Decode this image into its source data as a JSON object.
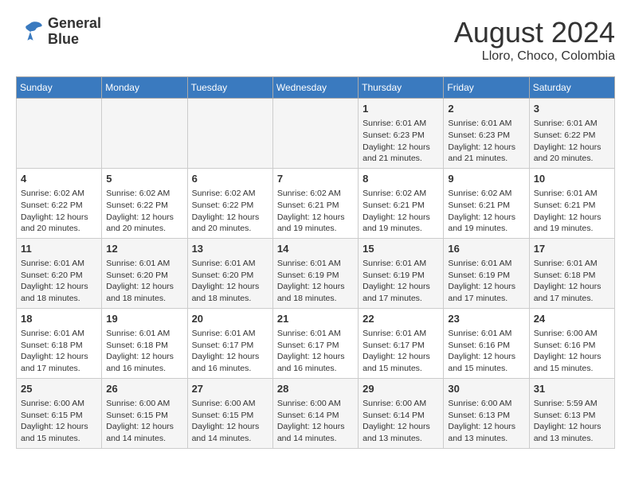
{
  "header": {
    "logo": {
      "line1": "General",
      "line2": "Blue"
    },
    "title": "August 2024",
    "subtitle": "Lloro, Choco, Colombia"
  },
  "days_of_week": [
    "Sunday",
    "Monday",
    "Tuesday",
    "Wednesday",
    "Thursday",
    "Friday",
    "Saturday"
  ],
  "weeks": [
    [
      {
        "day": "",
        "info": ""
      },
      {
        "day": "",
        "info": ""
      },
      {
        "day": "",
        "info": ""
      },
      {
        "day": "",
        "info": ""
      },
      {
        "day": "1",
        "info": "Sunrise: 6:01 AM\nSunset: 6:23 PM\nDaylight: 12 hours\nand 21 minutes."
      },
      {
        "day": "2",
        "info": "Sunrise: 6:01 AM\nSunset: 6:23 PM\nDaylight: 12 hours\nand 21 minutes."
      },
      {
        "day": "3",
        "info": "Sunrise: 6:01 AM\nSunset: 6:22 PM\nDaylight: 12 hours\nand 20 minutes."
      }
    ],
    [
      {
        "day": "4",
        "info": "Sunrise: 6:02 AM\nSunset: 6:22 PM\nDaylight: 12 hours\nand 20 minutes."
      },
      {
        "day": "5",
        "info": "Sunrise: 6:02 AM\nSunset: 6:22 PM\nDaylight: 12 hours\nand 20 minutes."
      },
      {
        "day": "6",
        "info": "Sunrise: 6:02 AM\nSunset: 6:22 PM\nDaylight: 12 hours\nand 20 minutes."
      },
      {
        "day": "7",
        "info": "Sunrise: 6:02 AM\nSunset: 6:21 PM\nDaylight: 12 hours\nand 19 minutes."
      },
      {
        "day": "8",
        "info": "Sunrise: 6:02 AM\nSunset: 6:21 PM\nDaylight: 12 hours\nand 19 minutes."
      },
      {
        "day": "9",
        "info": "Sunrise: 6:02 AM\nSunset: 6:21 PM\nDaylight: 12 hours\nand 19 minutes."
      },
      {
        "day": "10",
        "info": "Sunrise: 6:01 AM\nSunset: 6:21 PM\nDaylight: 12 hours\nand 19 minutes."
      }
    ],
    [
      {
        "day": "11",
        "info": "Sunrise: 6:01 AM\nSunset: 6:20 PM\nDaylight: 12 hours\nand 18 minutes."
      },
      {
        "day": "12",
        "info": "Sunrise: 6:01 AM\nSunset: 6:20 PM\nDaylight: 12 hours\nand 18 minutes."
      },
      {
        "day": "13",
        "info": "Sunrise: 6:01 AM\nSunset: 6:20 PM\nDaylight: 12 hours\nand 18 minutes."
      },
      {
        "day": "14",
        "info": "Sunrise: 6:01 AM\nSunset: 6:19 PM\nDaylight: 12 hours\nand 18 minutes."
      },
      {
        "day": "15",
        "info": "Sunrise: 6:01 AM\nSunset: 6:19 PM\nDaylight: 12 hours\nand 17 minutes."
      },
      {
        "day": "16",
        "info": "Sunrise: 6:01 AM\nSunset: 6:19 PM\nDaylight: 12 hours\nand 17 minutes."
      },
      {
        "day": "17",
        "info": "Sunrise: 6:01 AM\nSunset: 6:18 PM\nDaylight: 12 hours\nand 17 minutes."
      }
    ],
    [
      {
        "day": "18",
        "info": "Sunrise: 6:01 AM\nSunset: 6:18 PM\nDaylight: 12 hours\nand 17 minutes."
      },
      {
        "day": "19",
        "info": "Sunrise: 6:01 AM\nSunset: 6:18 PM\nDaylight: 12 hours\nand 16 minutes."
      },
      {
        "day": "20",
        "info": "Sunrise: 6:01 AM\nSunset: 6:17 PM\nDaylight: 12 hours\nand 16 minutes."
      },
      {
        "day": "21",
        "info": "Sunrise: 6:01 AM\nSunset: 6:17 PM\nDaylight: 12 hours\nand 16 minutes."
      },
      {
        "day": "22",
        "info": "Sunrise: 6:01 AM\nSunset: 6:17 PM\nDaylight: 12 hours\nand 15 minutes."
      },
      {
        "day": "23",
        "info": "Sunrise: 6:01 AM\nSunset: 6:16 PM\nDaylight: 12 hours\nand 15 minutes."
      },
      {
        "day": "24",
        "info": "Sunrise: 6:00 AM\nSunset: 6:16 PM\nDaylight: 12 hours\nand 15 minutes."
      }
    ],
    [
      {
        "day": "25",
        "info": "Sunrise: 6:00 AM\nSunset: 6:15 PM\nDaylight: 12 hours\nand 15 minutes."
      },
      {
        "day": "26",
        "info": "Sunrise: 6:00 AM\nSunset: 6:15 PM\nDaylight: 12 hours\nand 14 minutes."
      },
      {
        "day": "27",
        "info": "Sunrise: 6:00 AM\nSunset: 6:15 PM\nDaylight: 12 hours\nand 14 minutes."
      },
      {
        "day": "28",
        "info": "Sunrise: 6:00 AM\nSunset: 6:14 PM\nDaylight: 12 hours\nand 14 minutes."
      },
      {
        "day": "29",
        "info": "Sunrise: 6:00 AM\nSunset: 6:14 PM\nDaylight: 12 hours\nand 13 minutes."
      },
      {
        "day": "30",
        "info": "Sunrise: 6:00 AM\nSunset: 6:13 PM\nDaylight: 12 hours\nand 13 minutes."
      },
      {
        "day": "31",
        "info": "Sunrise: 5:59 AM\nSunset: 6:13 PM\nDaylight: 12 hours\nand 13 minutes."
      }
    ]
  ]
}
